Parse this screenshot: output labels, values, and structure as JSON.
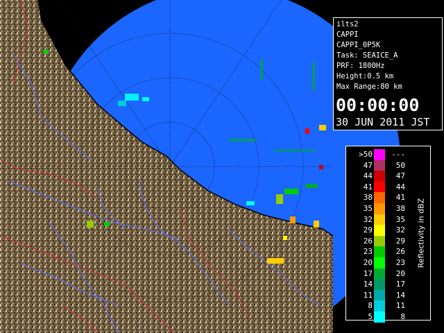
{
  "info_panel": {
    "station": "ilts2",
    "product": "CAPPI",
    "product_name": "CAPPI_0P5K",
    "task": "Task: SEAICE_A",
    "prf": "PRF: 1800Hz",
    "height": "Height:0.5 km",
    "max_range": "Max Range:80 km",
    "time": "00:00:00",
    "date": "30 JUN 2011 JST"
  },
  "legend": {
    "unit_label": "Reflectivity in dBZ",
    "rows": [
      {
        "lo": ">50",
        "hi": "---",
        "color": "#ff00ff"
      },
      {
        "lo": "47",
        "hi": "50",
        "color": "#b03060"
      },
      {
        "lo": "44",
        "hi": "47",
        "color": "#cc0000"
      },
      {
        "lo": "41",
        "hi": "44",
        "color": "#ff0000"
      },
      {
        "lo": "38",
        "hi": "41",
        "color": "#ff6600"
      },
      {
        "lo": "35",
        "hi": "38",
        "color": "#ff9900"
      },
      {
        "lo": "32",
        "hi": "35",
        "color": "#ffcc00"
      },
      {
        "lo": "29",
        "hi": "32",
        "color": "#ffff00"
      },
      {
        "lo": "26",
        "hi": "29",
        "color": "#99cc00"
      },
      {
        "lo": "23",
        "hi": "26",
        "color": "#00cc00"
      },
      {
        "lo": "20",
        "hi": "23",
        "color": "#00ff00"
      },
      {
        "lo": "17",
        "hi": "20",
        "color": "#00aa33"
      },
      {
        "lo": "14",
        "hi": "17",
        "color": "#009966"
      },
      {
        "lo": "11",
        "hi": "14",
        "color": "#00aaaa"
      },
      {
        "lo": "8",
        "hi": "11",
        "color": "#00ccdd"
      },
      {
        "lo": "5",
        "hi": "8",
        "color": "#00ffff"
      }
    ]
  },
  "colors": {
    "sea": "#1a66ff",
    "land": "#6b5a40",
    "range_ring": "#1a1a1a",
    "river": "#5566ff",
    "boundary": "#dd3344"
  }
}
